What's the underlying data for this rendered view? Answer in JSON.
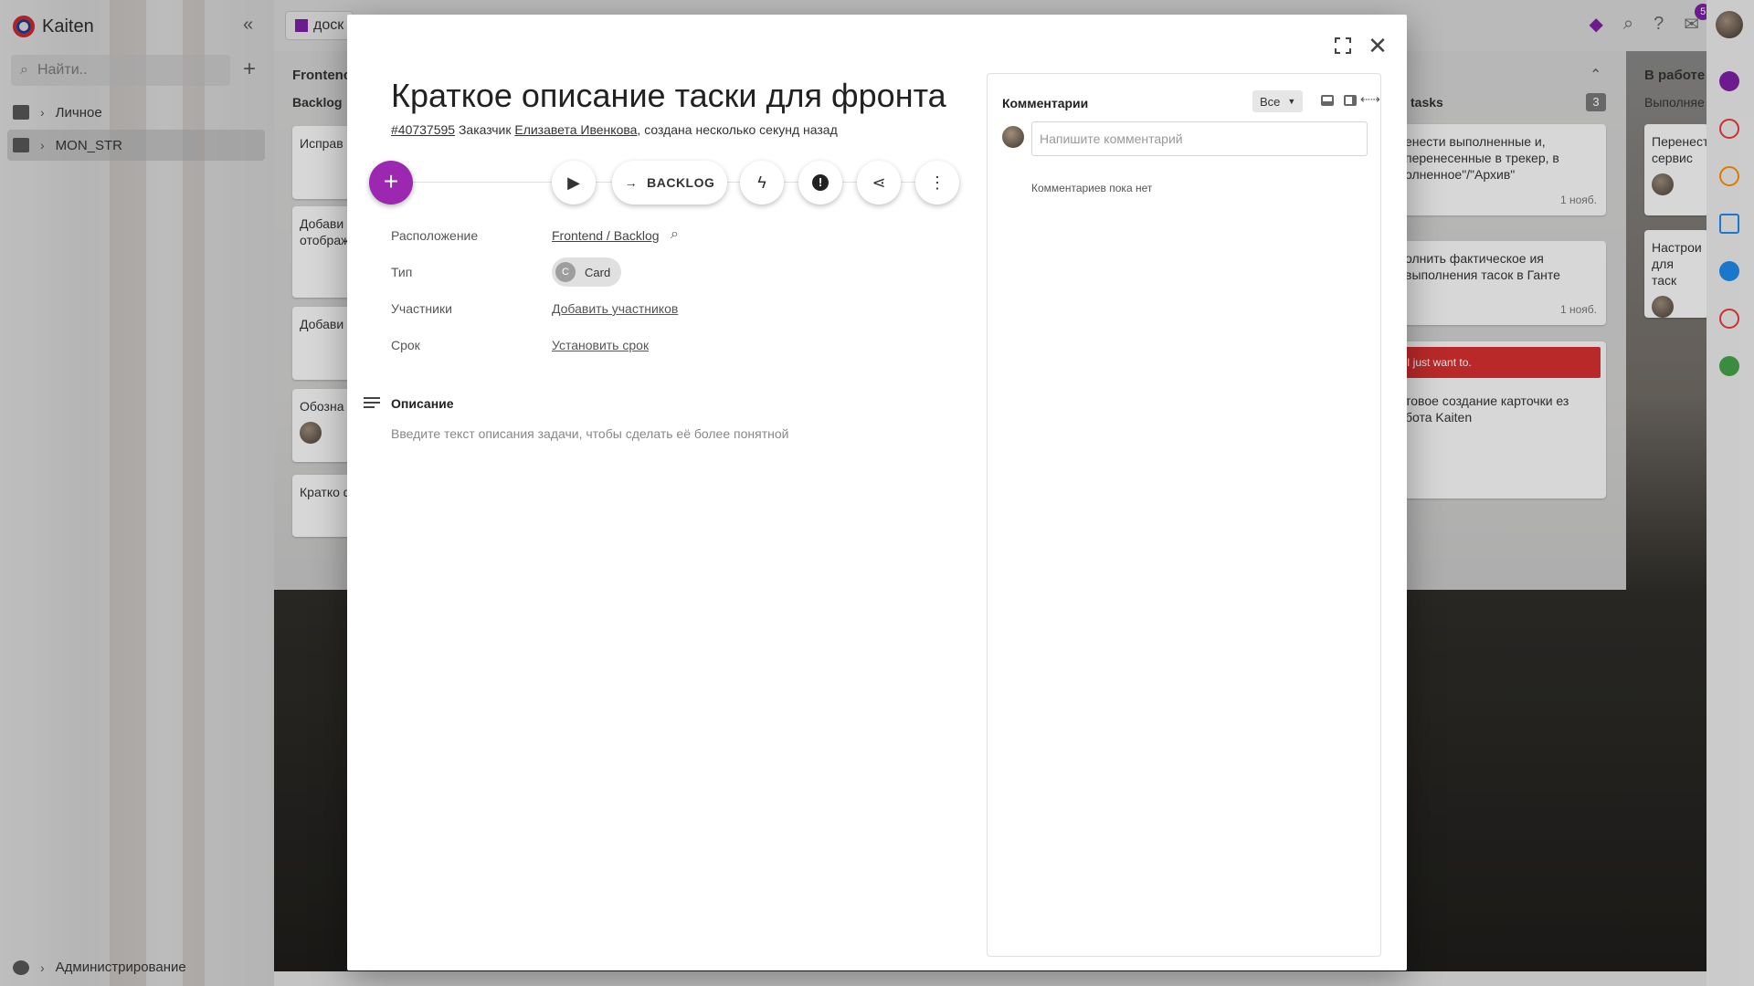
{
  "app": {
    "name": "Kaiten",
    "search_placeholder": "Найти..",
    "spaces": [
      {
        "label": "Личное"
      },
      {
        "label": "MON_STR"
      }
    ],
    "admin_label": "Администрирование",
    "notification_count": "5"
  },
  "board": {
    "tab_label": "доск",
    "columns": [
      {
        "title": "Frontenc",
        "sub": "Backlog"
      },
      {
        "title": "В работе",
        "sub": "Выполняе"
      }
    ],
    "tasks_label": "tasks",
    "tasks_count": "3",
    "left_cards": [
      "Исправ",
      "Добави отображ",
      "Добави",
      "Обозна",
      "Кратко фронта"
    ],
    "middle_cards": [
      {
        "text": "енести выполненные и, перенесенные в трекер, в олненное\"/\"Архив\"",
        "date": "1 нояб."
      },
      {
        "text": "олнить фактическое ия выполнения тасок в Ганте",
        "date": "1 нояб."
      },
      {
        "tag": "I just want to.",
        "text": "товое создание карточки ез бота Kaiten"
      }
    ],
    "right_cards": [
      "Перенест сервис",
      "Настрои для таск"
    ]
  },
  "card": {
    "title": "Краткое описание таски для фронта",
    "id": "#40737595",
    "meta_prefix": "Заказчик",
    "customer": "Елизавета Ивенкова",
    "meta_suffix": ", создана несколько секунд назад",
    "move_label": "BACKLOG",
    "props": {
      "location_label": "Расположение",
      "location_value": "Frontend / Backlog",
      "type_label": "Тип",
      "type_initial": "C",
      "type_value": "Card",
      "members_label": "Участники",
      "members_value": "Добавить участников",
      "deadline_label": "Срок",
      "deadline_value": "Установить срок"
    },
    "description": {
      "heading": "Описание",
      "placeholder": "Введите текст описания задачи, чтобы сделать её более понятной"
    }
  },
  "comments": {
    "title": "Комментарии",
    "filter": "Все",
    "input_placeholder": "Напишите комментарий",
    "empty_text": "Комментариев пока нет"
  },
  "colors": {
    "accent": "#9c27b0",
    "tag_red": "#d32f2f"
  }
}
